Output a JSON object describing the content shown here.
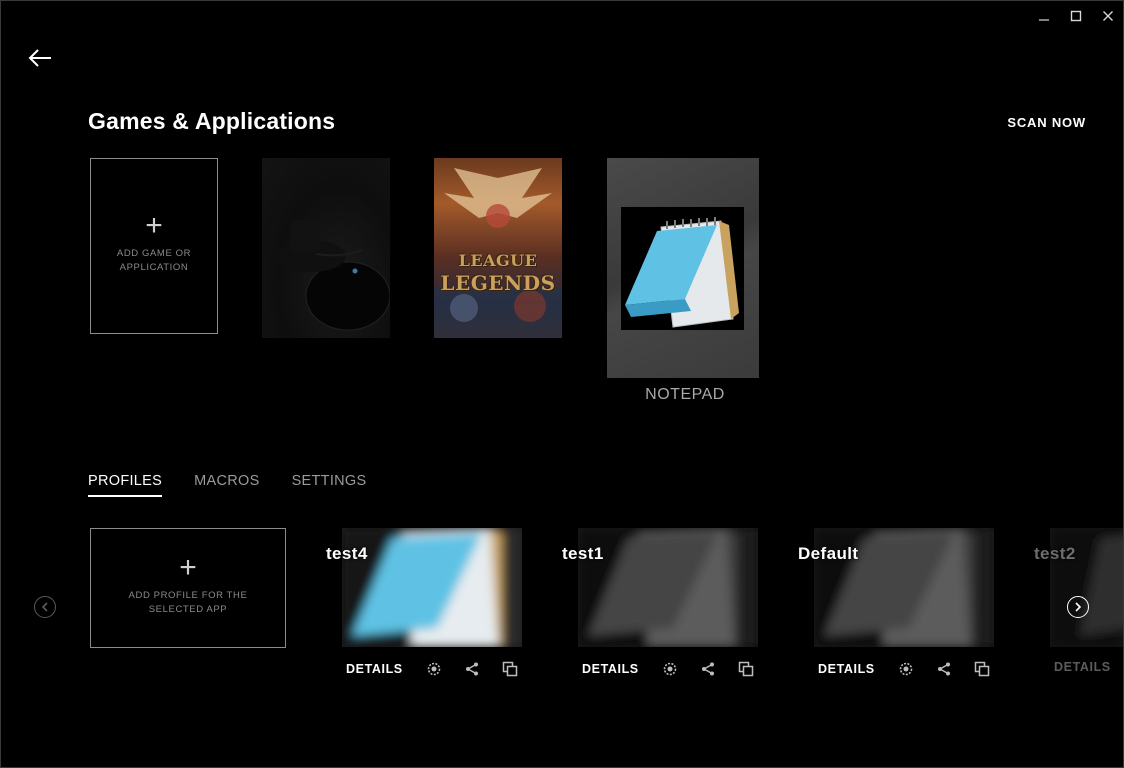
{
  "window": {
    "controls": {
      "minimize_icon": "minimize-icon",
      "maximize_icon": "maximize-icon",
      "close_icon": "close-icon"
    }
  },
  "header": {
    "back_icon": "arrow-left-icon",
    "title": "Games & Applications",
    "scan_now": "SCAN NOW"
  },
  "games": {
    "add_tile_label": "ADD GAME OR APPLICATION",
    "items": [
      {
        "id": "mouse",
        "label": ""
      },
      {
        "id": "league",
        "logo_line1": "LEAGUE",
        "logo_line2": "LEGENDS",
        "label": ""
      },
      {
        "id": "notepad",
        "label": "NOTEPAD"
      }
    ]
  },
  "tabs": [
    {
      "label": "PROFILES",
      "active": true
    },
    {
      "label": "MACROS",
      "active": false
    },
    {
      "label": "SETTINGS",
      "active": false
    }
  ],
  "profiles": {
    "add_tile_label": "ADD PROFILE FOR THE SELECTED APP",
    "details_label": "DETAILS",
    "items": [
      {
        "name": "test4",
        "active": true
      },
      {
        "name": "test1",
        "active": false
      },
      {
        "name": "Default",
        "active": false
      },
      {
        "name": "test2",
        "active": false
      }
    ],
    "action_icons": [
      "persistent-icon",
      "share-icon",
      "copy-icon"
    ]
  },
  "colors": {
    "background": "#000000",
    "text_primary": "#ffffff",
    "text_muted": "#9a9a9a",
    "border": "#8c8c8c"
  }
}
